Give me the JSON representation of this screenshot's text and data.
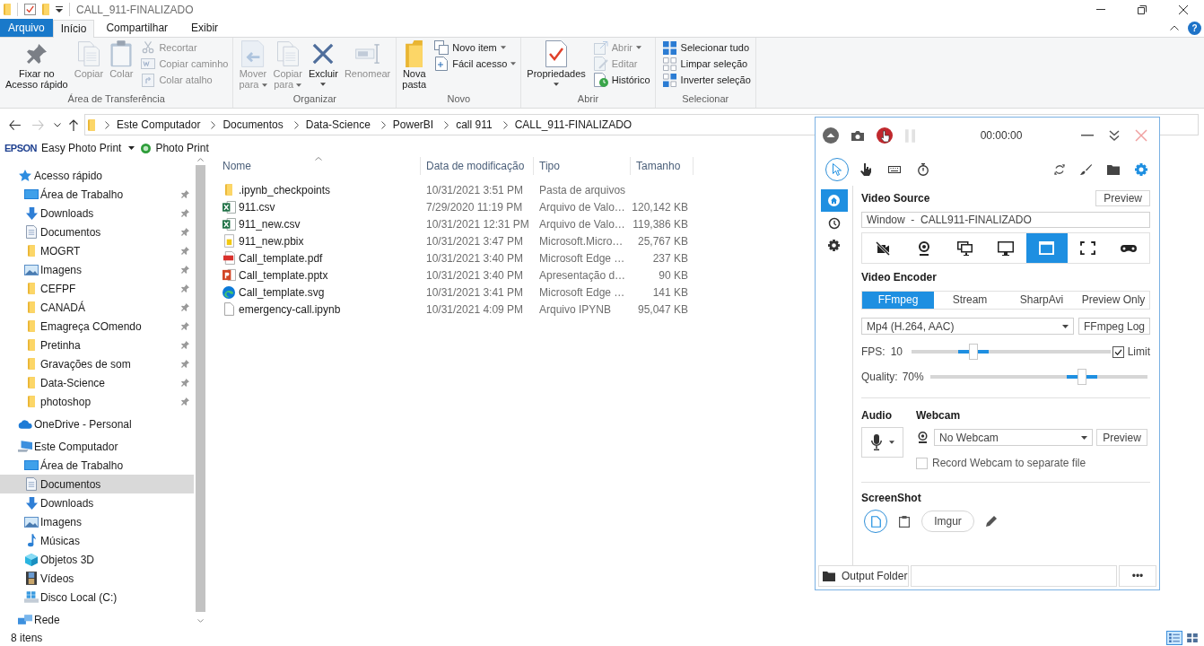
{
  "window": {
    "title": "CALL_911-FINALIZADO"
  },
  "ribbon_tabs": [
    {
      "label": "Arquivo",
      "kind": "file",
      "selected": false
    },
    {
      "label": "Início",
      "kind": "tab",
      "selected": true
    },
    {
      "label": "Compartilhar",
      "kind": "tab",
      "selected": false
    },
    {
      "label": "Exibir",
      "kind": "tab",
      "selected": false
    }
  ],
  "help_button": "?",
  "ribbon_groups": [
    {
      "label": "Área de Transferência",
      "items": [
        {
          "kind": "large",
          "label": "Fixar no\nAcesso rápido",
          "dropdown": false,
          "disabled": false
        },
        {
          "kind": "large",
          "label": "Copiar",
          "dropdown": false,
          "disabled": true
        },
        {
          "kind": "large",
          "label": "Colar",
          "dropdown": false,
          "disabled": true
        },
        {
          "kind": "small",
          "label": "Recortar",
          "dropdown": false,
          "disabled": true
        },
        {
          "kind": "small",
          "label": "Copiar caminho",
          "dropdown": false,
          "disabled": true
        },
        {
          "kind": "small",
          "label": "Colar atalho",
          "dropdown": false,
          "disabled": true
        }
      ]
    },
    {
      "label": "Organizar",
      "items": [
        {
          "kind": "large",
          "label": "Mover\npara",
          "dropdown": true,
          "disabled": true
        },
        {
          "kind": "large",
          "label": "Copiar\npara",
          "dropdown": true,
          "disabled": true
        },
        {
          "kind": "large",
          "label": "Excluir",
          "dropdown": true,
          "disabled": false
        },
        {
          "kind": "large",
          "label": "Renomear",
          "dropdown": false,
          "disabled": true
        }
      ]
    },
    {
      "label": "Novo",
      "items": [
        {
          "kind": "large",
          "label": "Nova\npasta",
          "dropdown": false,
          "disabled": false
        },
        {
          "kind": "small",
          "label": "Novo item",
          "dropdown": true,
          "disabled": false
        },
        {
          "kind": "small",
          "label": "Fácil acesso",
          "dropdown": true,
          "disabled": false
        }
      ]
    },
    {
      "label": "Abrir",
      "items": [
        {
          "kind": "large",
          "label": "Propriedades",
          "dropdown": true,
          "disabled": false
        },
        {
          "kind": "small",
          "label": "Abrir",
          "dropdown": true,
          "disabled": true
        },
        {
          "kind": "small",
          "label": "Editar",
          "dropdown": false,
          "disabled": true
        },
        {
          "kind": "small",
          "label": "Histórico",
          "dropdown": false,
          "disabled": false
        }
      ]
    },
    {
      "label": "Selecionar",
      "items": [
        {
          "kind": "small",
          "label": "Selecionar tudo",
          "dropdown": false,
          "disabled": false
        },
        {
          "kind": "small",
          "label": "Limpar seleção",
          "dropdown": false,
          "disabled": false
        },
        {
          "kind": "small",
          "label": "Inverter seleção",
          "dropdown": false,
          "disabled": false
        }
      ]
    }
  ],
  "address_bar": {
    "nav": [
      {
        "kind": "back",
        "disabled": false
      },
      {
        "kind": "forward",
        "disabled": true
      },
      {
        "kind": "recent",
        "disabled": false
      },
      {
        "kind": "up",
        "disabled": false
      }
    ],
    "breadcrumbs": [
      "Este Computador",
      "Documentos",
      "Data-Science",
      "PowerBI",
      "call 911",
      "CALL_911-FINALIZADO"
    ]
  },
  "epson_toolbar": {
    "logo": "EPSON",
    "items": [
      {
        "label": "Easy Photo Print",
        "dropdown": true
      },
      {
        "label": "Photo Print",
        "dropdown": false
      }
    ]
  },
  "sidebar": {
    "items": [
      {
        "label": "Acesso rápido",
        "kind": "quick_access",
        "pinned": false,
        "selected": false,
        "children": [
          {
            "label": "Área de Trabalho",
            "kind": "desktop",
            "pinned": true,
            "selected": false
          },
          {
            "label": "Downloads",
            "kind": "downloads",
            "pinned": true,
            "selected": false
          },
          {
            "label": "Documentos",
            "kind": "documents",
            "pinned": true,
            "selected": false
          },
          {
            "label": "MOGRT",
            "kind": "folder",
            "pinned": true,
            "selected": false
          },
          {
            "label": "Imagens",
            "kind": "images",
            "pinned": true,
            "selected": false
          },
          {
            "label": "CEFPF",
            "kind": "folder",
            "pinned": true,
            "selected": false
          },
          {
            "label": "CANADÁ",
            "kind": "folder",
            "pinned": true,
            "selected": false
          },
          {
            "label": "Emagreça COmendo",
            "kind": "folder",
            "pinned": true,
            "selected": false
          },
          {
            "label": "Pretinha",
            "kind": "folder",
            "pinned": true,
            "selected": false
          },
          {
            "label": "Gravações de som",
            "kind": "folder",
            "pinned": true,
            "selected": false
          },
          {
            "label": "Data-Science",
            "kind": "folder",
            "pinned": true,
            "selected": false
          },
          {
            "label": "photoshop",
            "kind": "folder",
            "pinned": true,
            "selected": false
          }
        ]
      },
      {
        "label": "OneDrive - Personal",
        "kind": "cloud",
        "pinned": false,
        "selected": false
      },
      {
        "label": "Este Computador",
        "kind": "computer",
        "pinned": false,
        "selected": false,
        "children": [
          {
            "label": "Área de Trabalho",
            "kind": "desktop",
            "pinned": false,
            "selected": false
          },
          {
            "label": "Documentos",
            "kind": "documents",
            "pinned": false,
            "selected": true
          },
          {
            "label": "Downloads",
            "kind": "downloads",
            "pinned": false,
            "selected": false
          },
          {
            "label": "Imagens",
            "kind": "images",
            "pinned": false,
            "selected": false
          },
          {
            "label": "Músicas",
            "kind": "music",
            "pinned": false,
            "selected": false
          },
          {
            "label": "Objetos 3D",
            "kind": "objects3d",
            "pinned": false,
            "selected": false
          },
          {
            "label": "Vídeos",
            "kind": "videos",
            "pinned": false,
            "selected": false
          },
          {
            "label": "Disco Local (C:)",
            "kind": "drive",
            "pinned": false,
            "selected": false
          }
        ]
      },
      {
        "label": "Rede",
        "kind": "network",
        "pinned": false,
        "selected": false
      }
    ]
  },
  "file_list": {
    "columns": [
      {
        "label": "Nome",
        "sorted": true
      },
      {
        "label": "Data de modificação",
        "sorted": false
      },
      {
        "label": "Tipo",
        "sorted": false
      },
      {
        "label": "Tamanho",
        "sorted": false
      }
    ],
    "rows": [
      {
        "kind": "folder",
        "name": ".ipynb_checkpoints",
        "modified": "10/31/2021 3:51 PM",
        "type": "Pasta de arquivos",
        "selected": false
      },
      {
        "kind": "spreadsheet",
        "name": "911.csv",
        "modified": "7/29/2020 11:19 PM",
        "type": "Arquivo de Valo…",
        "size": "120,142 KB",
        "selected": false
      },
      {
        "kind": "spreadsheet",
        "name": "911_new.csv",
        "modified": "10/31/2021 12:31 PM",
        "type": "Arquivo de Valo…",
        "size": "119,386 KB",
        "selected": false
      },
      {
        "kind": "report",
        "name": "911_new.pbix",
        "modified": "10/31/2021 3:47 PM",
        "type": "Microsoft.Micro…",
        "size": "25,767 KB",
        "selected": false
      },
      {
        "kind": "pdf",
        "name": "Call_template.pdf",
        "modified": "10/31/2021 3:40 PM",
        "type": "Microsoft Edge …",
        "size": "237 KB",
        "selected": false
      },
      {
        "kind": "presentation",
        "name": "Call_template.pptx",
        "modified": "10/31/2021 3:40 PM",
        "type": "Apresentação d…",
        "size": "90 KB",
        "selected": false
      },
      {
        "kind": "web",
        "name": "Call_template.svg",
        "modified": "10/31/2021 3:41 PM",
        "type": "Microsoft Edge …",
        "size": "141 KB",
        "selected": false
      },
      {
        "kind": "file",
        "name": "emergency-call.ipynb",
        "modified": "10/31/2021 4:09 PM",
        "type": "Arquivo IPYNB",
        "size": "95,047 KB",
        "selected": false
      }
    ]
  },
  "status_bar": {
    "count": "8 itens",
    "views": [
      {
        "kind": "details",
        "selected": true
      },
      {
        "kind": "large_icons",
        "selected": false
      }
    ]
  },
  "recorder": {
    "timer": "00:00:00",
    "tools": [
      {
        "kind": "cursor",
        "on": true
      },
      {
        "kind": "clicks",
        "on": false
      },
      {
        "kind": "keystrokes",
        "on": false
      },
      {
        "kind": "timer",
        "on": false
      }
    ],
    "nav": [
      {
        "kind": "home",
        "selected": true
      },
      {
        "kind": "history",
        "selected": false
      },
      {
        "kind": "settings",
        "selected": false
      }
    ],
    "video_source": {
      "heading": "Video Source",
      "preview": "Preview",
      "value": "Window  -  CALL911-FINALIZADO",
      "sources": [
        {
          "kind": "none",
          "selected": false
        },
        {
          "kind": "webcam",
          "selected": false
        },
        {
          "kind": "multi_screen",
          "selected": false
        },
        {
          "kind": "screen",
          "selected": false
        },
        {
          "kind": "window",
          "selected": true
        },
        {
          "kind": "region",
          "selected": false
        },
        {
          "kind": "game",
          "selected": false
        }
      ]
    },
    "video_encoder": {
      "heading": "Video Encoder",
      "tabs": [
        {
          "label": "FFmpeg",
          "selected": true
        },
        {
          "label": "Stream",
          "selected": false
        },
        {
          "label": "SharpAvi",
          "selected": false
        },
        {
          "label": "Preview Only",
          "selected": false
        }
      ],
      "format": "Mp4 (H.264, AAC)",
      "log_button": "FFmpeg Log",
      "fps": {
        "label": "FPS:",
        "reading": "10",
        "level": 0.31
      },
      "limit": {
        "label": "Limit",
        "checked": true
      },
      "quality": {
        "label": "Quality:",
        "reading": "70%",
        "level": 0.7
      }
    },
    "audio": {
      "heading": "Audio"
    },
    "webcam": {
      "heading": "Webcam",
      "value": "No Webcam",
      "preview": "Preview",
      "separate_file": {
        "label": "Record Webcam to separate file",
        "checked": false
      }
    },
    "screenshot": {
      "heading": "ScreenShot",
      "targets": [
        {
          "kind": "disk",
          "selected": true
        },
        {
          "kind": "clipboard",
          "selected": false
        },
        {
          "kind": "imgur",
          "label": "Imgur",
          "selected": false
        },
        {
          "kind": "editor",
          "selected": false
        }
      ]
    },
    "output": {
      "label": "Output Folder",
      "more": "•••"
    }
  }
}
